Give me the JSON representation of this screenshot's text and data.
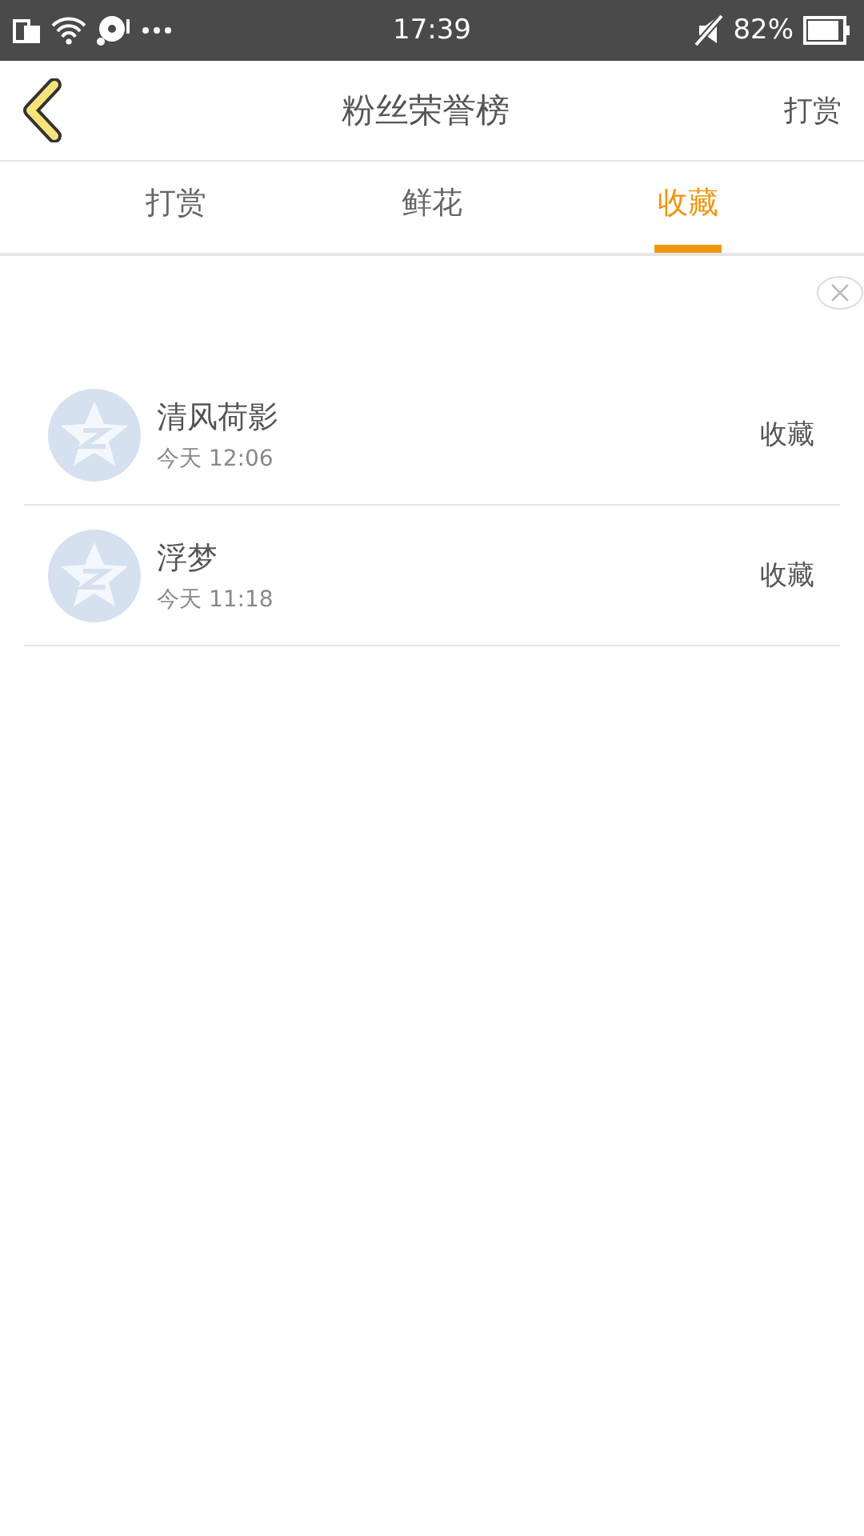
{
  "status_bar": {
    "time": "17:39",
    "battery_percent": "82%"
  },
  "header": {
    "title": "粉丝荣誉榜",
    "action": "打赏"
  },
  "tabs": [
    {
      "label": "打赏",
      "selected": false
    },
    {
      "label": "鲜花",
      "selected": false
    },
    {
      "label": "收藏",
      "selected": true
    }
  ],
  "rows": [
    {
      "name": "清风荷影",
      "time": "今天 12:06",
      "action": "收藏"
    },
    {
      "name": "浮梦",
      "time": "今天 11:18",
      "action": "收藏"
    }
  ]
}
